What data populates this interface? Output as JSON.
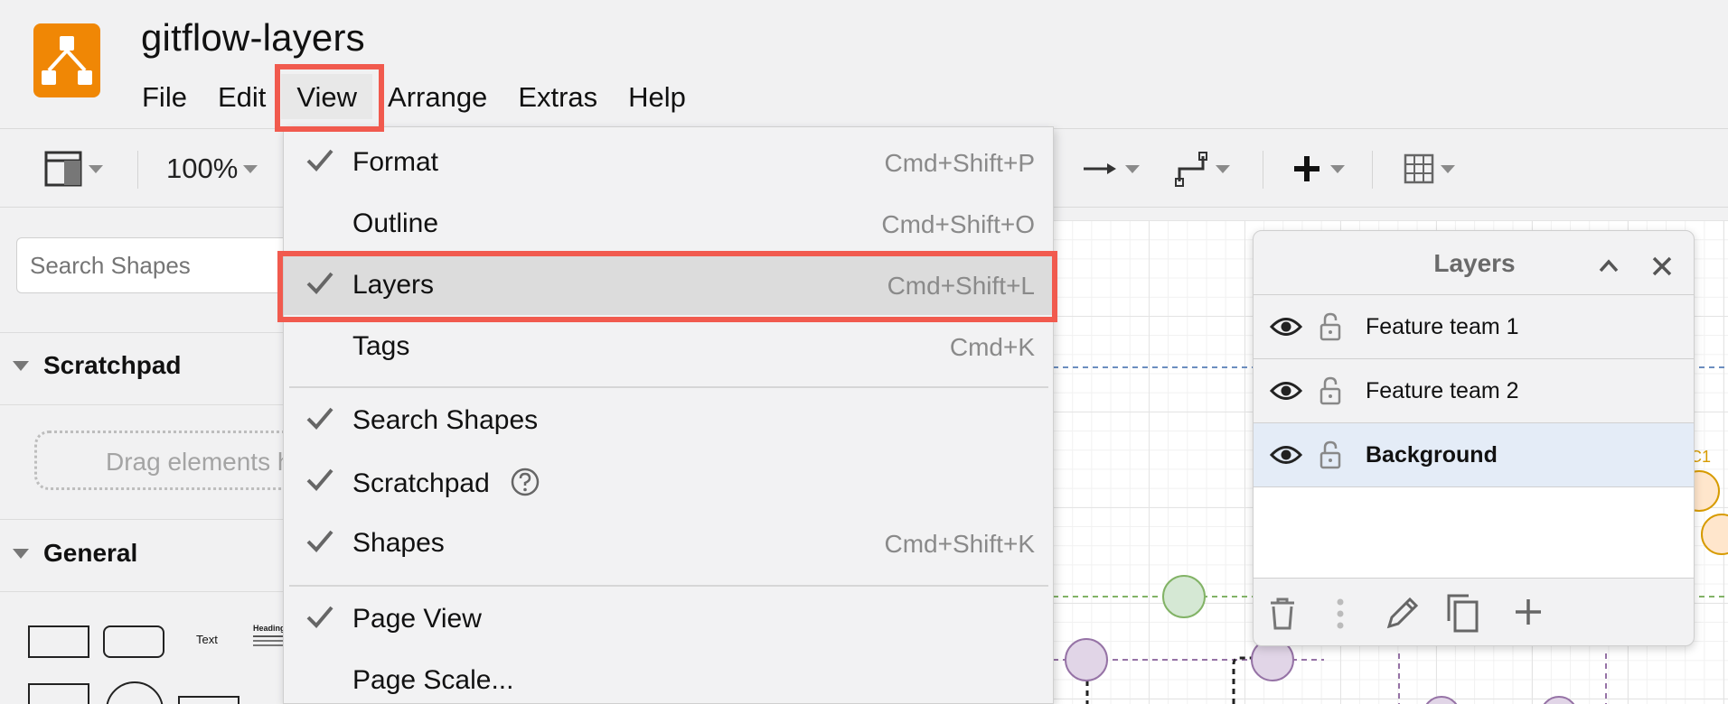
{
  "app": {
    "title": "gitflow-layers",
    "logo_icon": "drawio-logo-icon",
    "brand_color": "#f08705"
  },
  "menubar": {
    "items": [
      {
        "label": "File"
      },
      {
        "label": "Edit"
      },
      {
        "label": "View",
        "active": true
      },
      {
        "label": "Arrange"
      },
      {
        "label": "Extras"
      },
      {
        "label": "Help"
      }
    ]
  },
  "toolbar": {
    "zoom": "100%",
    "icons": [
      "format-panel-icon",
      "arrow-right-icon",
      "waypoint-icon",
      "plus-icon",
      "table-icon"
    ]
  },
  "sidebar": {
    "search_placeholder": "Search Shapes",
    "scratchpad_label": "Scratchpad",
    "drag_hint": "Drag elements here",
    "general_label": "General",
    "shape_text": "Text",
    "shape_heading": "Heading"
  },
  "view_menu": {
    "items": [
      {
        "label": "Format",
        "checked": true,
        "shortcut": "Cmd+Shift+P"
      },
      {
        "label": "Outline",
        "checked": false,
        "shortcut": "Cmd+Shift+O"
      },
      {
        "label": "Layers",
        "checked": true,
        "shortcut": "Cmd+Shift+L",
        "highlighted": true
      },
      {
        "label": "Tags",
        "checked": false,
        "shortcut": "Cmd+K"
      },
      {
        "label": "Search Shapes",
        "checked": true,
        "shortcut": ""
      },
      {
        "label": "Scratchpad",
        "checked": true,
        "shortcut": "",
        "help_icon": true
      },
      {
        "label": "Shapes",
        "checked": true,
        "shortcut": "Cmd+Shift+K"
      },
      {
        "label": "Page View",
        "checked": true,
        "shortcut": ""
      },
      {
        "label": "Page Scale...",
        "checked": false,
        "shortcut": ""
      }
    ]
  },
  "layers_panel": {
    "title": "Layers",
    "layers": [
      {
        "name": "Feature team 1",
        "visible": true,
        "locked": false,
        "selected": false
      },
      {
        "name": "Feature team 2",
        "visible": true,
        "locked": false,
        "selected": false
      },
      {
        "name": "Background",
        "visible": true,
        "locked": false,
        "selected": true
      }
    ],
    "footer_icons": [
      "trash-icon",
      "more-vertical-icon",
      "pencil-icon",
      "duplicate-icon",
      "add-icon"
    ]
  },
  "canvas": {
    "node_label": "C1",
    "colors": {
      "green": "#d5e8d4",
      "purple": "#e1d5e7",
      "orange": "#ffe6cc",
      "blue_line": "#6c8ebf"
    }
  },
  "highlight_color": "#f15a4e"
}
